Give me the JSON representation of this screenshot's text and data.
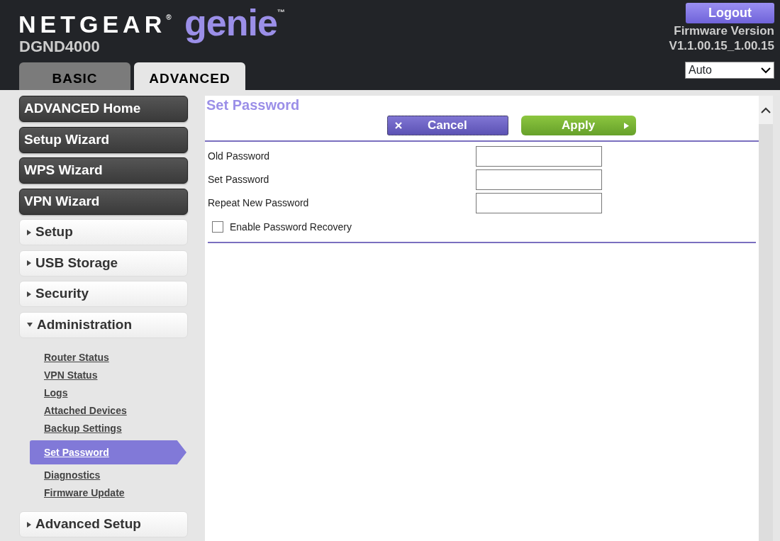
{
  "header": {
    "logo": {
      "brand": "NETGEAR$^{®}$",
      "product": "genie$^{™}$"
    },
    "model": "DGND4000",
    "logout": "Logout",
    "firmware_label": "Firmware Version",
    "firmware_version": "V1.1.00.15_1.00.15",
    "language": {
      "value": "Auto"
    }
  },
  "tabs": [
    {
      "label": "BASIC",
      "selected": false
    },
    {
      "label": "ADVANCED",
      "selected": true
    }
  ],
  "sidebar": {
    "items": [
      {
        "kind": "wizard",
        "label": "ADVANCED Home"
      },
      {
        "kind": "wizard",
        "label": "Setup Wizard"
      },
      {
        "kind": "wizard",
        "label": "WPS Wizard"
      },
      {
        "kind": "wizard",
        "label": "VPN Wizard"
      },
      {
        "kind": "section",
        "label": "Setup",
        "expanded": false
      },
      {
        "kind": "section",
        "label": "USB Storage",
        "expanded": false
      },
      {
        "kind": "section",
        "label": "Security",
        "expanded": false
      },
      {
        "kind": "section",
        "label": "Administration",
        "expanded": true,
        "children": [
          {
            "label": "Router Status",
            "selected": false
          },
          {
            "label": "VPN Status",
            "selected": false
          },
          {
            "label": "Logs",
            "selected": false
          },
          {
            "label": "Attached Devices",
            "selected": false
          },
          {
            "label": "Backup Settings",
            "selected": false
          },
          {
            "label": "Set Password",
            "selected": true
          },
          {
            "label": "Diagnostics",
            "selected": false
          },
          {
            "label": "Firmware Update",
            "selected": false
          }
        ]
      },
      {
        "kind": "section",
        "label": "Advanced Setup",
        "expanded": false
      }
    ]
  },
  "content": {
    "title": "Set Password",
    "buttons": [
      {
        "kind": "cancel",
        "label": "Cancel"
      },
      {
        "kind": "apply",
        "label": "Apply"
      }
    ],
    "fields": [
      {
        "label": "Old Password"
      },
      {
        "label": "Set Password"
      },
      {
        "label": "Repeat New Password"
      }
    ],
    "checkbox": {
      "label": "Enable Password Recovery",
      "checked": false
    }
  }
}
